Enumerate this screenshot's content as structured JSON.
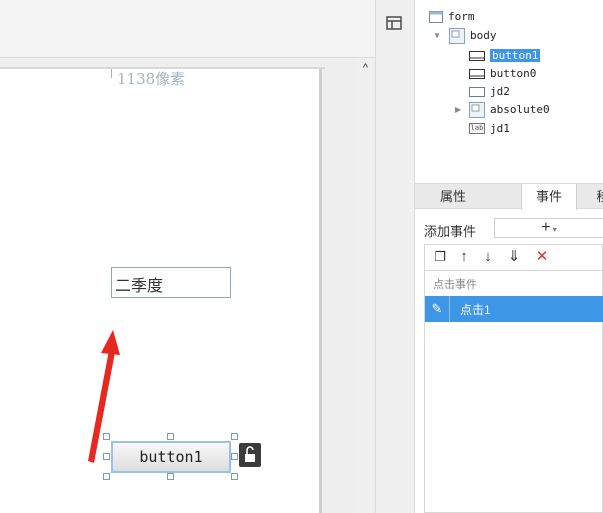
{
  "canvas": {
    "width_label": "1138像素",
    "textfield_value": "二季度",
    "button_label": "button1"
  },
  "tree": {
    "nodes": [
      {
        "label": "form",
        "type": "form"
      },
      {
        "label": "body",
        "type": "container"
      },
      {
        "label": "button1",
        "type": "button",
        "selected": true
      },
      {
        "label": "button0",
        "type": "button"
      },
      {
        "label": "jd2",
        "type": "textfield"
      },
      {
        "label": "absolute0",
        "type": "container"
      },
      {
        "label": "jd1",
        "type": "label"
      }
    ],
    "label_icon_text": "lab"
  },
  "tabs": [
    {
      "label": "属性",
      "active": false
    },
    {
      "label": "事件",
      "active": true
    },
    {
      "label": "移",
      "active": false
    }
  ],
  "events": {
    "add_label": "添加事件",
    "add_button_text": "+",
    "group_label": "点击事件",
    "items": [
      {
        "label": "点击1",
        "selected": true
      }
    ]
  },
  "colors": {
    "accent": "#3e96e6",
    "arrow": "#e8281f",
    "delete": "#e03030"
  }
}
